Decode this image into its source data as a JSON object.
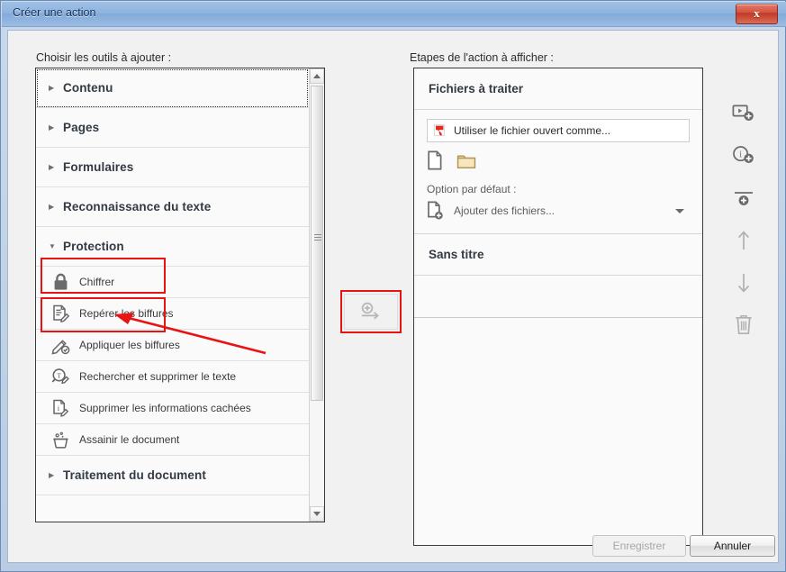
{
  "window": {
    "title": "Créer une action",
    "close_label": "x"
  },
  "left_panel": {
    "label": "Choisir les outils à ajouter :",
    "categories": [
      {
        "label": "Contenu",
        "expanded": false,
        "caret": "collapsed-caret-icon"
      },
      {
        "label": "Pages",
        "expanded": false,
        "caret": "collapsed-caret-icon"
      },
      {
        "label": "Formulaires",
        "expanded": false,
        "caret": "collapsed-caret-icon"
      },
      {
        "label": "Reconnaissance du texte",
        "expanded": false,
        "caret": "collapsed-caret-icon"
      },
      {
        "label": "Protection",
        "expanded": true,
        "caret": "expanded-caret-icon"
      },
      {
        "label": "Traitement du document",
        "expanded": false,
        "caret": "collapsed-caret-icon"
      }
    ],
    "protection_tools": [
      {
        "label": "Chiffrer",
        "icon": "lock-icon"
      },
      {
        "label": "Repérer les biffures",
        "icon": "mark-redactions-icon"
      },
      {
        "label": "Appliquer les biffures",
        "icon": "apply-redactions-icon"
      },
      {
        "label": "Rechercher et supprimer le texte",
        "icon": "search-remove-text-icon"
      },
      {
        "label": "Supprimer les informations cachées",
        "icon": "remove-hidden-info-icon"
      },
      {
        "label": "Assainir le document",
        "icon": "sanitize-document-icon"
      }
    ],
    "scrollbar": {
      "up_icon": "scroll-up-arrow-icon",
      "down_icon": "scroll-down-arrow-icon"
    }
  },
  "center": {
    "add_icon": "add-step-arrow-icon"
  },
  "right_panel": {
    "label": "Etapes de l'action à afficher :",
    "sections": [
      {
        "title": "Fichiers à traiter"
      },
      {
        "title": "Sans titre"
      }
    ],
    "file_field": {
      "text": "Utiliser le fichier ouvert comme...",
      "icon": "pdf-file-icon"
    },
    "source_icons": [
      {
        "icon": "document-icon"
      },
      {
        "icon": "folder-icon"
      }
    ],
    "default_option_label": "Option par défaut :",
    "default_option_value": "Ajouter des fichiers...",
    "default_option_icon": "add-file-icon",
    "default_option_caret": "chevron-down-icon"
  },
  "toolbar": {
    "buttons": [
      {
        "icon": "add-panel-icon"
      },
      {
        "icon": "add-instruction-icon"
      },
      {
        "icon": "add-divider-icon"
      },
      {
        "icon": "move-up-arrow-icon"
      },
      {
        "icon": "move-down-arrow-icon"
      },
      {
        "icon": "delete-trash-icon"
      }
    ]
  },
  "footer": {
    "save_label": "Enregistrer",
    "cancel_label": "Annuler",
    "save_enabled": false
  },
  "annotations": {
    "accent_color": "#e81313",
    "boxes": [
      "Protection",
      "Chiffrer"
    ],
    "arrow_points_to": "Chiffrer"
  },
  "colors": {
    "titlebar_blue": "#8fb4de",
    "close_red": "#d4543f",
    "annotation_red": "#e81313",
    "panel_bg": "#fafafa",
    "client_bg": "#f1f1f1"
  }
}
